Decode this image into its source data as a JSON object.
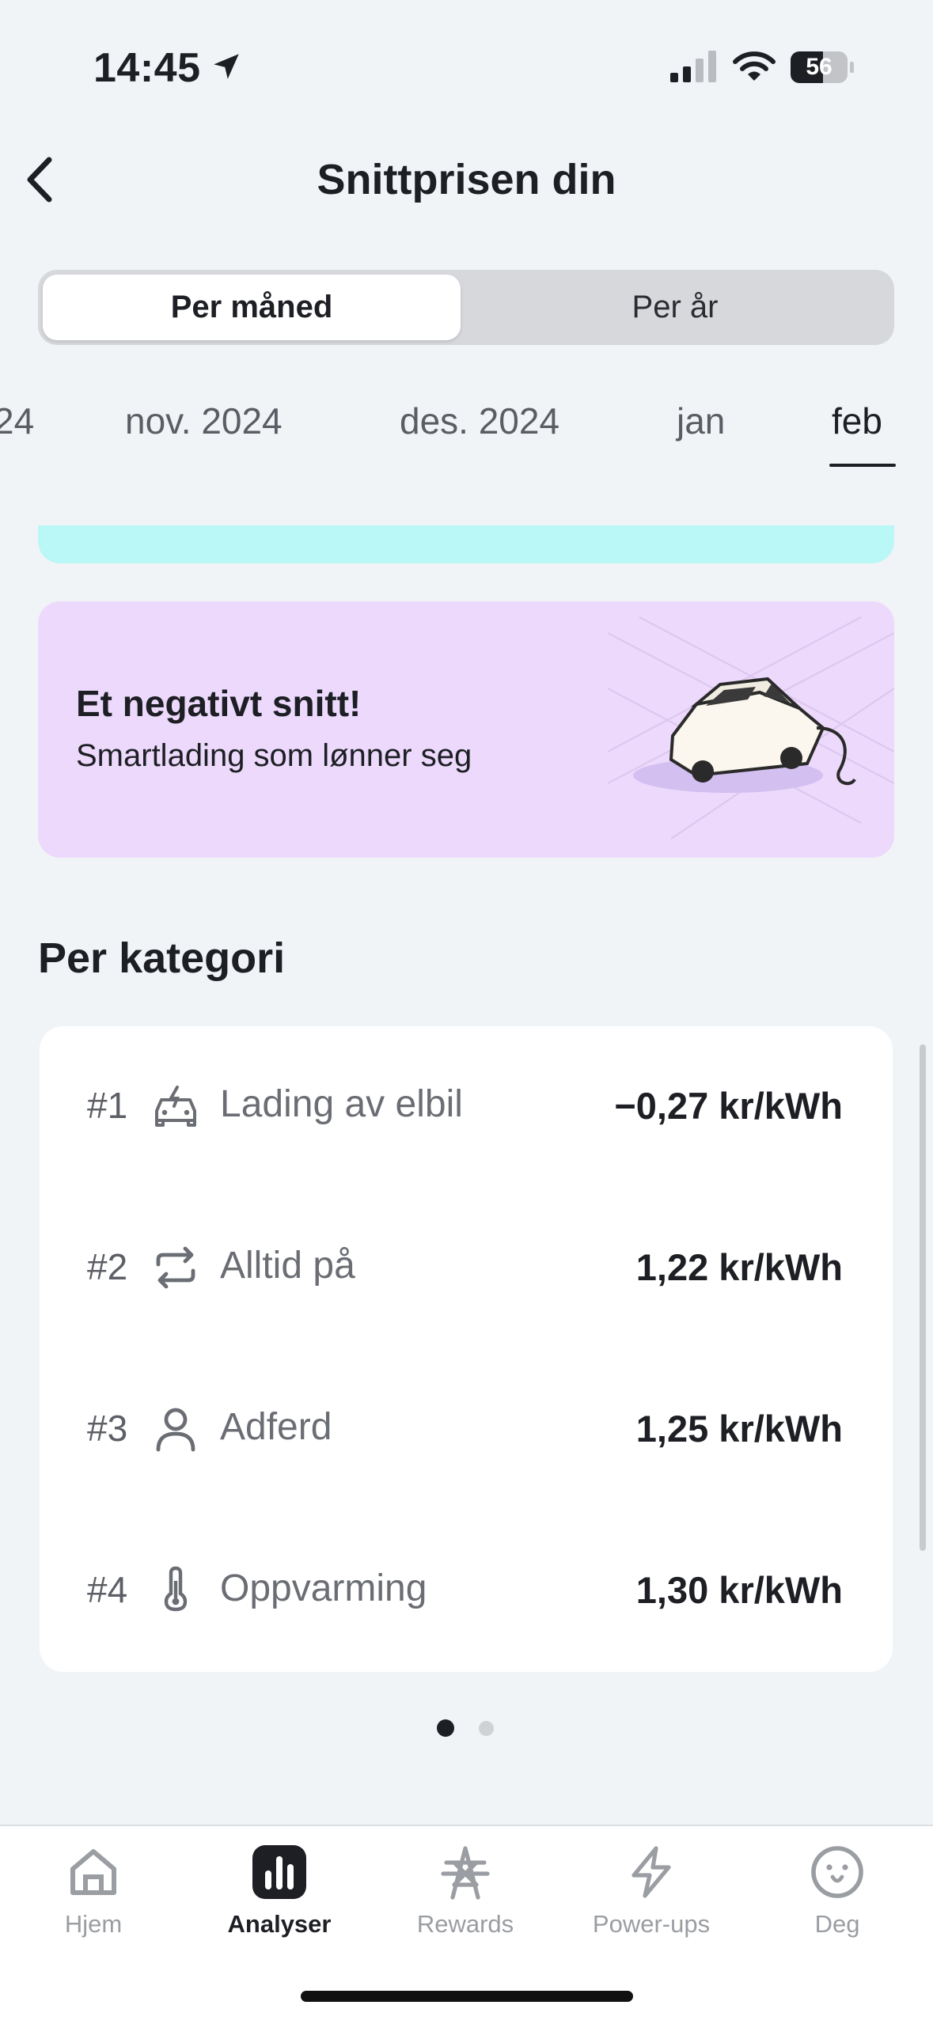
{
  "status_bar": {
    "time": "14:45",
    "battery": "56"
  },
  "header": {
    "title": "Snittprisen din"
  },
  "segment": {
    "options": [
      "Per måned",
      "Per år"
    ],
    "selected": "Per måned"
  },
  "months": [
    "24",
    "nov. 2024",
    "des. 2024",
    "jan",
    "feb"
  ],
  "active_month": "feb",
  "promo": {
    "title": "Et negativt snitt!",
    "subtitle": "Smartlading som lønner seg"
  },
  "category_section": {
    "title": "Per kategori",
    "rows": [
      {
        "rank": "#1",
        "icon": "car-charging-icon",
        "label": "Lading av elbil",
        "value": "−0,27 kr/kWh"
      },
      {
        "rank": "#2",
        "icon": "repeat-icon",
        "label": "Alltid på",
        "value": "1,22 kr/kWh"
      },
      {
        "rank": "#3",
        "icon": "person-icon",
        "label": "Adferd",
        "value": "1,25 kr/kWh"
      },
      {
        "rank": "#4",
        "icon": "thermometer-icon",
        "label": "Oppvarming",
        "value": "1,30 kr/kWh"
      }
    ]
  },
  "pagination": {
    "pages": 2,
    "current": 1
  },
  "tabbar": {
    "items": [
      {
        "label": "Hjem",
        "icon": "home-icon"
      },
      {
        "label": "Analyser",
        "icon": "bar-chart-icon"
      },
      {
        "label": "Rewards",
        "icon": "pylon-icon"
      },
      {
        "label": "Power-ups",
        "icon": "lightning-icon"
      },
      {
        "label": "Deg",
        "icon": "face-icon"
      }
    ],
    "active": "Analyser"
  },
  "colors": {
    "accent_cyan": "#baf7f7",
    "promo_purple": "#ecd9fb",
    "background": "#f1f4f7"
  }
}
